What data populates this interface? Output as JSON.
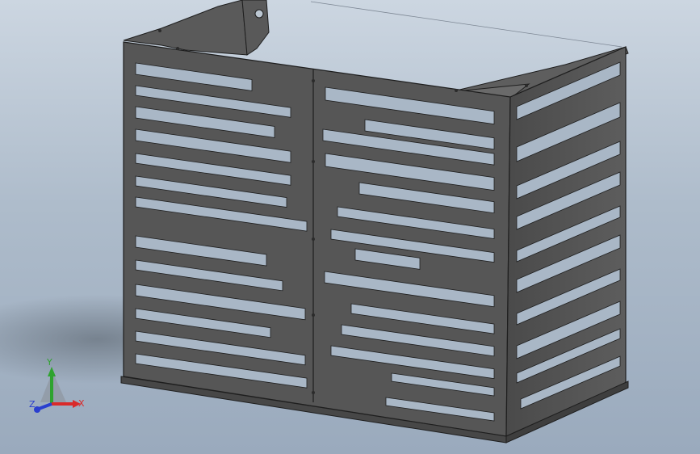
{
  "viewport": {
    "background_top": "#ccd6e1",
    "background_bottom": "#9aaabd",
    "model_color": "#565656",
    "model_edge_color": "#1e1e1e",
    "opening_color": "#a9b7c6"
  },
  "triad": {
    "x_label": "X",
    "y_label": "Y",
    "z_label": "Z",
    "x_color": "#d92a2a",
    "y_color": "#2fa32f",
    "z_color": "#2a3fcf"
  }
}
